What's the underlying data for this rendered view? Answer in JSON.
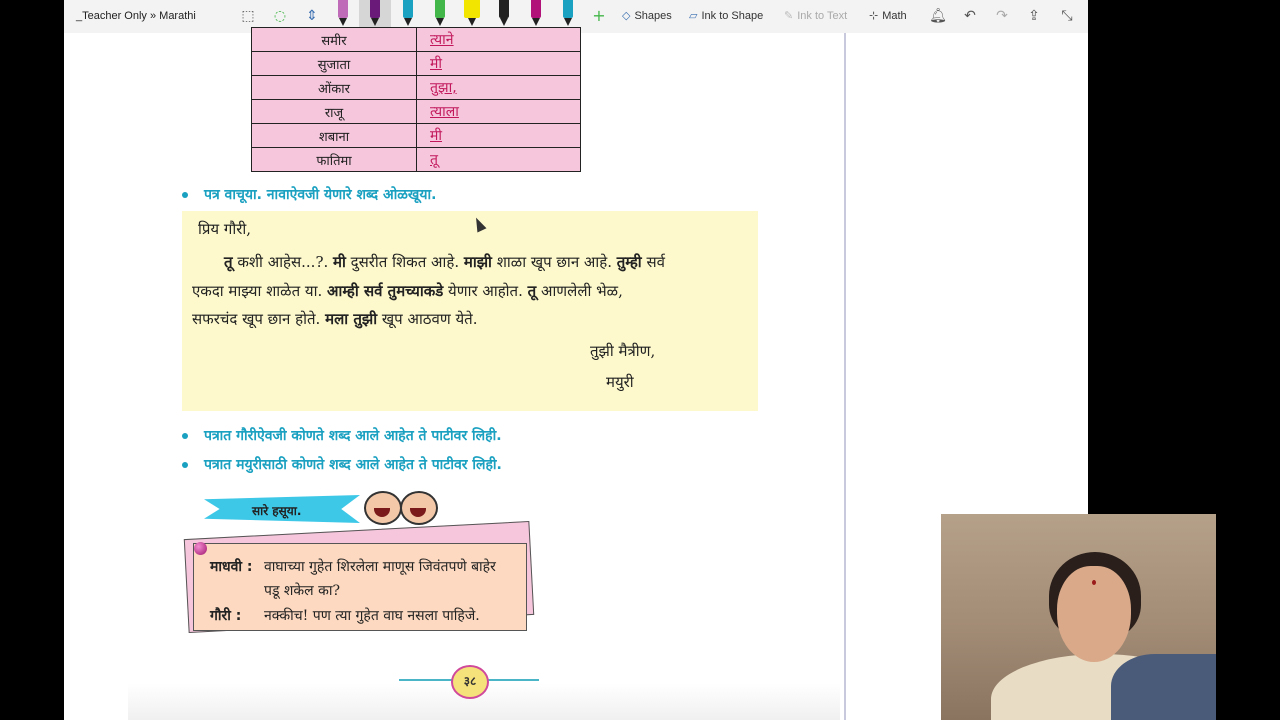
{
  "toolbar": {
    "breadcrumb": "_Teacher Only » Marathi",
    "shapes_label": "Shapes",
    "ink_to_shape_label": "Ink to Shape",
    "ink_to_text_label": "Ink to Text",
    "math_label": "Math",
    "pen_colors": [
      "#c06bb8",
      "#6a1b7a",
      "#1aa0c0",
      "#43b649",
      "#f2e500",
      "#222222",
      "#b0127a",
      "#1aa0c0"
    ],
    "icons": [
      "lasso-select-icon",
      "add-space-icon",
      "insert-space-icon",
      "plus-icon",
      "bell-icon",
      "undo-icon",
      "redo-icon",
      "share-icon",
      "collapse-icon"
    ]
  },
  "names_table": {
    "rows": [
      {
        "name": "समीर",
        "word": "त्याने"
      },
      {
        "name": "सुजाता",
        "word": "मी"
      },
      {
        "name": "ओंकार",
        "word": "तुझा,"
      },
      {
        "name": "राजू",
        "word": "त्याला"
      },
      {
        "name": "शबाना",
        "word": "मी"
      },
      {
        "name": "फातिमा",
        "word": "तू"
      }
    ]
  },
  "instruction_1": "पत्र वाचूया. नावाऐवजी येणारे शब्द ओळखूया.",
  "letter": {
    "salutation": "प्रिय गौरी,",
    "line1_a": "तू",
    "line1_b": " कशी आहेस...?. ",
    "line1_c": "मी",
    "line1_d": " दुसरीत शिकत आहे. ",
    "line1_e": "माझी",
    "line1_f": " शाळा खूप छान आहे. ",
    "line1_g": "तुम्ही",
    "line1_h": " सर्व",
    "line2_a": "एकदा माझ्या शाळेत या. ",
    "line2_b": "आम्ही सर्व तुमच्याकडे",
    "line2_c": " येणार आहोत. ",
    "line2_d": "तू",
    "line2_e": " आणलेली भेळ,",
    "line3_a": "सफरचंद खूप छान होते. ",
    "line3_b": "मला तुझी",
    "line3_c": " खूप आठवण येते.",
    "closing": "तुझी मैत्रीण,",
    "signature": "मयुरी"
  },
  "instruction_2": "पत्रात गौरीऐवजी कोणते शब्द आले आहेत ते पाटीवर लिही.",
  "instruction_3": "पत्रात मयुरीसाठी कोणते शब्द आले आहेत ते पाटीवर लिही.",
  "banner_label": "सारे हसूया.",
  "joke": {
    "speaker1": "माधवी :",
    "line1": "वाघाच्या गुहेत शिरलेला माणूस जिवंतपणे बाहेर",
    "line1b": "पडू शकेल का?",
    "speaker2": "गौरी   :",
    "line2": "नक्कीच! पण त्या गुहेत वाघ नसला पाहिजे."
  },
  "page_number": "३८"
}
